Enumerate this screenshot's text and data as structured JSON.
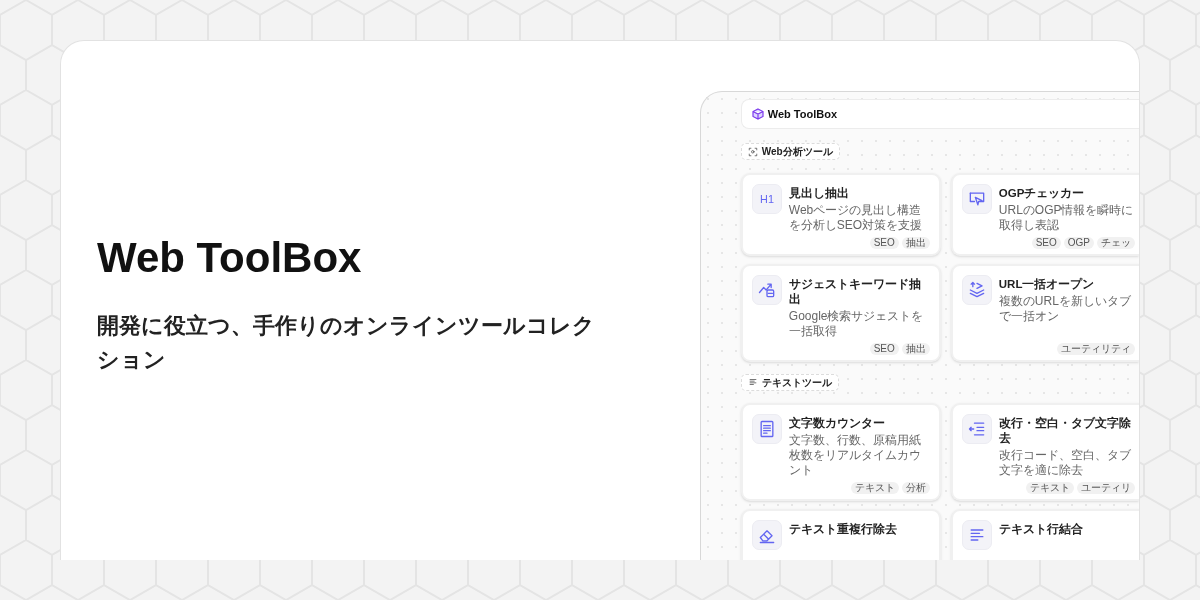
{
  "hero": {
    "title": "Web ToolBox",
    "subtitle": "開発に役立つ、手作りのオンラインツールコレクション"
  },
  "preview": {
    "brand": "Web ToolBox",
    "sections": [
      {
        "label": "Web分析ツール",
        "kind": "scan",
        "tools": [
          {
            "kind": "h1",
            "icon_text": "H1",
            "title": "見出し抽出",
            "description": "Webページの見出し構造を分析しSEO対策を支援",
            "tags": [
              "SEO",
              "抽出"
            ]
          },
          {
            "kind": "cursor",
            "title": "OGPチェッカー",
            "description": "URLのOGP情報を瞬時に取得し表認",
            "tags": [
              "SEO",
              "OGP",
              "チェッ"
            ]
          },
          {
            "kind": "trend",
            "title": "サジェストキーワード抽出",
            "description": "Google検索サジェストを一括取得",
            "tags": [
              "SEO",
              "抽出"
            ]
          },
          {
            "kind": "layers",
            "title": "URL一括オープン",
            "description": "複数のURLを新しいタブで一括オン",
            "tags": [
              "ユーティリティ"
            ]
          }
        ]
      },
      {
        "label": "テキストツール",
        "kind": "lines",
        "tools": [
          {
            "kind": "document",
            "title": "文字数カウンター",
            "description": "文字数、行数、原稿用紙枚数をリアルタイムカウント",
            "tags": [
              "テキスト",
              "分析"
            ]
          },
          {
            "kind": "indent",
            "title": "改行・空白・タブ文字除去",
            "description": "改行コード、空白、タブ文字を適に除去",
            "tags": [
              "テキスト",
              "ユーティリ"
            ]
          },
          {
            "kind": "eraser",
            "title": "テキスト重複行除去"
          },
          {
            "kind": "lines",
            "title": "テキスト行結合"
          }
        ]
      }
    ]
  }
}
